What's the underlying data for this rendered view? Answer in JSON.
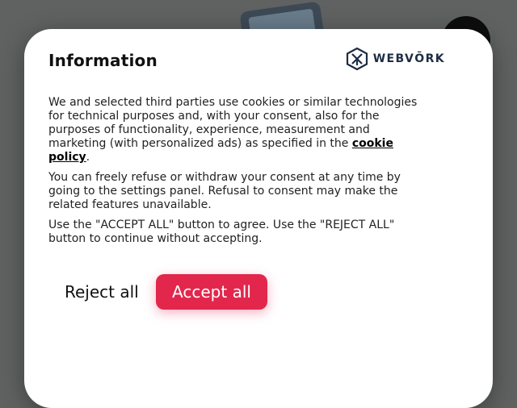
{
  "dialog": {
    "title": "Information",
    "logo": {
      "text": "WEBVŌRK",
      "icon": "webvork-logo-icon",
      "color": "#1d2d43"
    },
    "paragraph1_text": "We and selected third parties use cookies or similar technologies for technical purposes and, with your consent, also for the purposes of functionality, experience, measurement and marketing (with personalized ads) as specified in the ",
    "cookie_policy_link": "cookie policy",
    "paragraph1_end": ".",
    "paragraph2": "You can freely refuse or withdraw your consent at any time by going to the settings panel. Refusal to consent may make the related features unavailable.",
    "paragraph3": "Use the \"ACCEPT ALL\" button to agree. Use the \"REJECT ALL\" button to continue without accepting.",
    "reject_label": "Reject all",
    "accept_label": "Accept all",
    "accent_color": "#e3264c"
  }
}
